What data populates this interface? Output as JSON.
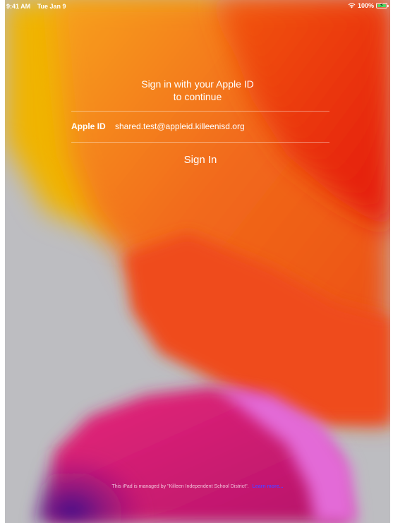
{
  "status_bar": {
    "time": "9:41 AM",
    "date": "Tue Jan 9",
    "battery": "100%",
    "battery_level": 1.0,
    "wifi_icon": "wifi-icon",
    "battery_icon": "battery-charging-icon",
    "battery_color": "#4cd964"
  },
  "signin": {
    "title_line1": "Sign in with your Apple ID",
    "title_line2": "to continue",
    "apple_id_label": "Apple ID",
    "apple_id_value": "shared.test@appleid.killeenisd.org",
    "sign_in_label": "Sign In"
  },
  "footer": {
    "managed_text": "This iPad is managed by \"Killeen Independent School District\".",
    "learn_more": "Learn more..."
  },
  "colors": {
    "wallpaper_gray": "#bdbdc1",
    "wallpaper_orange": "#f26a1b",
    "wallpaper_red": "#e3200d",
    "wallpaper_yellow": "#f0b400",
    "wallpaper_pink": "#d81d6e",
    "wallpaper_purple": "#4a0f8c",
    "link_color": "#5b3bff"
  }
}
